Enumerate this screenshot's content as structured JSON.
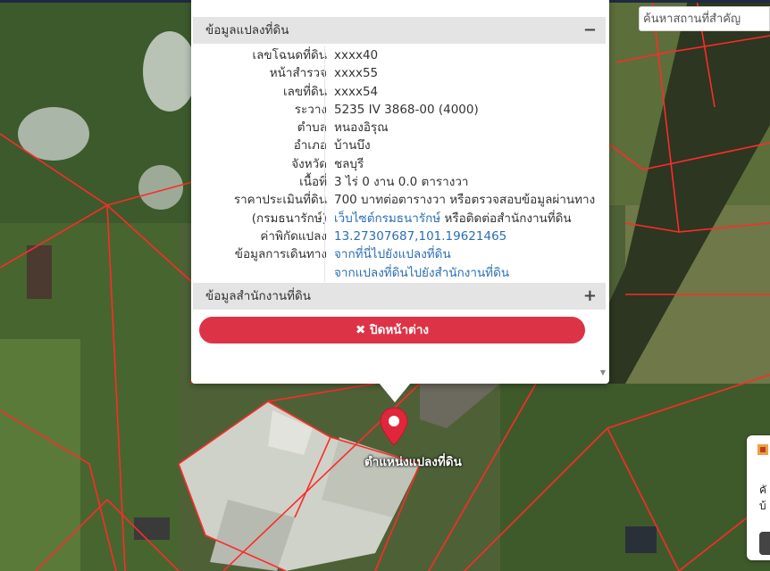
{
  "search": {
    "placeholder": "ค้นหาสถานที่สำคัญ"
  },
  "popup": {
    "land_info_header": "ข้อมูลแปลงที่ดิน",
    "land_info_toggle": "−",
    "rows": [
      {
        "label": "เลขโฉนดที่ดิน",
        "value": "xxxx40"
      },
      {
        "label": "หน้าสำรวจ",
        "value": "xxxx55"
      },
      {
        "label": "เลขที่ดิน",
        "value": "xxxx54"
      },
      {
        "label": "ระวาง",
        "value": "5235 IV 3868-00 (4000)"
      },
      {
        "label": "ตำบล",
        "value": "หนองอิรุณ"
      },
      {
        "label": "อำเภอ",
        "value": "บ้านบึง"
      },
      {
        "label": "จังหวัด",
        "value": "ชลบุรี"
      },
      {
        "label": "เนื้อที่",
        "value": "3 ไร่ 0 งาน 0.0 ตารางวา"
      },
      {
        "label": "ราคาประเมินที่ดิน",
        "value": "700 บาทต่อตารางวา หรือตรวจสอบข้อมูลผ่านทาง"
      },
      {
        "label": "(กรมธนารักษ์)",
        "value_link": "เว็บไซต์กรมธนารักษ์",
        "value_rest": " หรือติดต่อสำนักงานที่ดิน"
      },
      {
        "label": "ค่าพิกัดแปลง",
        "value_link": "13.27307687,101.19621465"
      },
      {
        "label": "ข้อมูลการเดินทาง",
        "value_link": "จากที่นี่ไปยังแปลงที่ดิน"
      },
      {
        "label": "",
        "value_link": "จากแปลงที่ดินไปยังสำนักงานที่ดิน"
      }
    ],
    "office_info_header": "ข้อมูลสำนักงานที่ดิน",
    "office_info_toggle": "+",
    "close_button": "✖ ปิดหน้าต่าง"
  },
  "marker": {
    "label": "ตำแหน่งแปลงที่ดิน",
    "color": "#e0263b"
  },
  "side_card": {
    "line1": "คั",
    "line2": "บ้"
  },
  "colors": {
    "accent": "#dd3347",
    "link": "#2a6fb5",
    "parcel_line": "#ff2a2a"
  }
}
